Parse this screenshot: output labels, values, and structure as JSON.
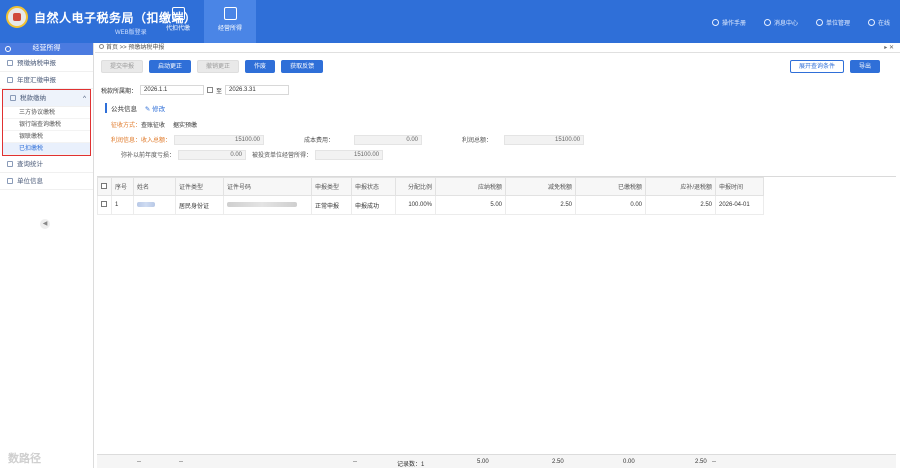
{
  "header": {
    "title": "自然人电子税务局（扣缴端）",
    "subtitle": "WEB版登录",
    "nav": [
      {
        "label": "代扣代缴",
        "active": false
      },
      {
        "label": "经营所得",
        "active": true
      }
    ],
    "tools": [
      "操作手册",
      "消息中心",
      "单位管理",
      "在线"
    ]
  },
  "sidebar": {
    "title": "经营所得",
    "items_top": [
      {
        "label": "预缴纳税申报"
      },
      {
        "label": "年度汇缴申报"
      }
    ],
    "group": {
      "label": "税款缴纳",
      "children": [
        {
          "label": "三方协议缴税",
          "active": false
        },
        {
          "label": "银行端查询缴税",
          "active": false
        },
        {
          "label": "银联缴税",
          "active": false
        },
        {
          "label": "已扣缴税",
          "active": true
        }
      ]
    },
    "items_bottom": [
      {
        "label": "查询统计"
      },
      {
        "label": "单位信息"
      }
    ],
    "collapse_glyph": "◀"
  },
  "main": {
    "breadcrumb": "首页 >> 预缴纳税申报",
    "window_controls": "▸ ✕",
    "toolbar": {
      "left": [
        {
          "label": "提交申报",
          "style": "dis"
        },
        {
          "label": "启动更正",
          "style": "pri"
        },
        {
          "label": "撤销更正",
          "style": "dis"
        },
        {
          "label": "作废",
          "style": "pri"
        },
        {
          "label": "获取反馈",
          "style": "pri"
        }
      ],
      "right": [
        {
          "label": "展开查询条件",
          "style": "ol"
        },
        {
          "label": "导出",
          "style": "pri"
        }
      ]
    },
    "period": {
      "label": "税款所属期：",
      "from": "2026.1.1",
      "sep": "至",
      "to": "2026.3.31"
    },
    "public_info": {
      "title": "公共信息",
      "edit": "修改",
      "collection_method_label": "征收方式：",
      "collection_method_value": "查账征收",
      "collection_method_note": "据实预缴",
      "profit_label": "利润信息：收入总额：",
      "income_total": "15100.00",
      "cost_label": "成本费用：",
      "cost": "0.00",
      "profit_total_label": "利润总额：",
      "profit_total": "15100.00",
      "loss_label": "弥补以前年度亏损：",
      "loss": "0.00",
      "investor_label": "被投资单位经营所得：",
      "investor_income": "15100.00"
    },
    "table": {
      "headers": [
        "序号",
        "姓名",
        "证件类型",
        "证件号码",
        "申报类型",
        "申报状态",
        "分配比例",
        "应纳税额",
        "减免税额",
        "已缴税额",
        "应补/退税额",
        "申报时间"
      ],
      "rows": [
        {
          "index": "1",
          "name": "",
          "id_type": "居民身份证",
          "id_no": "",
          "decl_type": "正常申报",
          "status": "申报成功",
          "ratio": "100.00%",
          "tax_due": "5.00",
          "tax_relief": "2.50",
          "tax_paid": "0.00",
          "tax_refund": "2.50",
          "decl_time": "2026-04-01"
        }
      ]
    },
    "footer": {
      "dashes": "--",
      "count_label": "记录数：1",
      "tax_due": "5.00",
      "tax_relief": "2.50",
      "tax_paid": "0.00",
      "tax_refund": "2.50"
    },
    "watermark": "数路径"
  },
  "colors": {
    "brand": "#2f6fd8",
    "highlight_border": "#e03131",
    "orange_label": "#e07a2a"
  }
}
